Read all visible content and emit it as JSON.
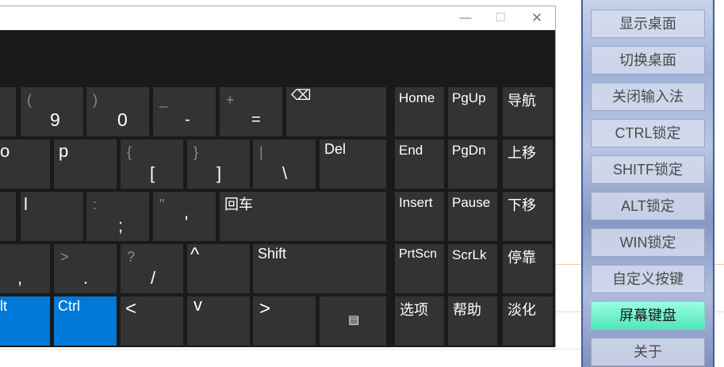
{
  "window": {
    "min_icon": "—",
    "max_icon": "☐",
    "close_icon": "✕"
  },
  "keys": {
    "r1": [
      {
        "id": "9",
        "sec": "(",
        "main": "9"
      },
      {
        "id": "0",
        "sec": ")",
        "main": "0"
      },
      {
        "id": "minus",
        "sec": "_",
        "main": "-"
      },
      {
        "id": "equals",
        "sec": "+",
        "main": "="
      },
      {
        "id": "backspace",
        "main": "⌫"
      }
    ],
    "r2": [
      {
        "id": "o",
        "main": "o"
      },
      {
        "id": "p",
        "main": "p"
      },
      {
        "id": "lbracket",
        "sec": "{",
        "main": "["
      },
      {
        "id": "rbracket",
        "sec": "}",
        "main": "]"
      },
      {
        "id": "backslash",
        "sec": "|",
        "main": "\\"
      },
      {
        "id": "del",
        "main": "Del"
      }
    ],
    "r3": [
      {
        "id": "l",
        "main": "l"
      },
      {
        "id": "semicolon",
        "sec": ":",
        "main": ";"
      },
      {
        "id": "quote",
        "sec": "\"",
        "main": "'"
      },
      {
        "id": "enter",
        "main": "回车"
      }
    ],
    "r4": [
      {
        "id": "comma",
        "main": ","
      },
      {
        "id": "period",
        "sec": ">",
        "main": "."
      },
      {
        "id": "slash",
        "sec": "?",
        "main": "/"
      },
      {
        "id": "up",
        "main": "^"
      },
      {
        "id": "shift",
        "main": "Shift"
      }
    ],
    "r5": [
      {
        "id": "alt",
        "main": "Alt"
      },
      {
        "id": "ctrl",
        "main": "Ctrl"
      },
      {
        "id": "left",
        "main": "<"
      },
      {
        "id": "down",
        "main": "v"
      },
      {
        "id": "right",
        "main": ">"
      },
      {
        "id": "menu",
        "main": "▤"
      }
    ],
    "nav": [
      {
        "id": "home",
        "main": "Home"
      },
      {
        "id": "pgup",
        "main": "PgUp"
      },
      {
        "id": "nav",
        "main": "导航"
      },
      {
        "id": "end",
        "main": "End"
      },
      {
        "id": "pgdn",
        "main": "PgDn"
      },
      {
        "id": "moveup",
        "main": "上移"
      },
      {
        "id": "insert",
        "main": "Insert"
      },
      {
        "id": "pause",
        "main": "Pause"
      },
      {
        "id": "movedown",
        "main": "下移"
      },
      {
        "id": "prtscn",
        "main": "PrtScn"
      },
      {
        "id": "scrlk",
        "main": "ScrLk"
      },
      {
        "id": "dock",
        "main": "停靠"
      },
      {
        "id": "options",
        "main": "选项"
      },
      {
        "id": "help",
        "main": "帮助"
      },
      {
        "id": "fade",
        "main": "淡化"
      }
    ]
  },
  "panel": {
    "buttons": [
      "显示桌面",
      "切换桌面",
      "关闭输入法",
      "CTRL锁定",
      "SHITF锁定",
      "ALT锁定",
      "WIN锁定",
      "自定义按键",
      "屏幕键盘",
      "关于"
    ]
  }
}
